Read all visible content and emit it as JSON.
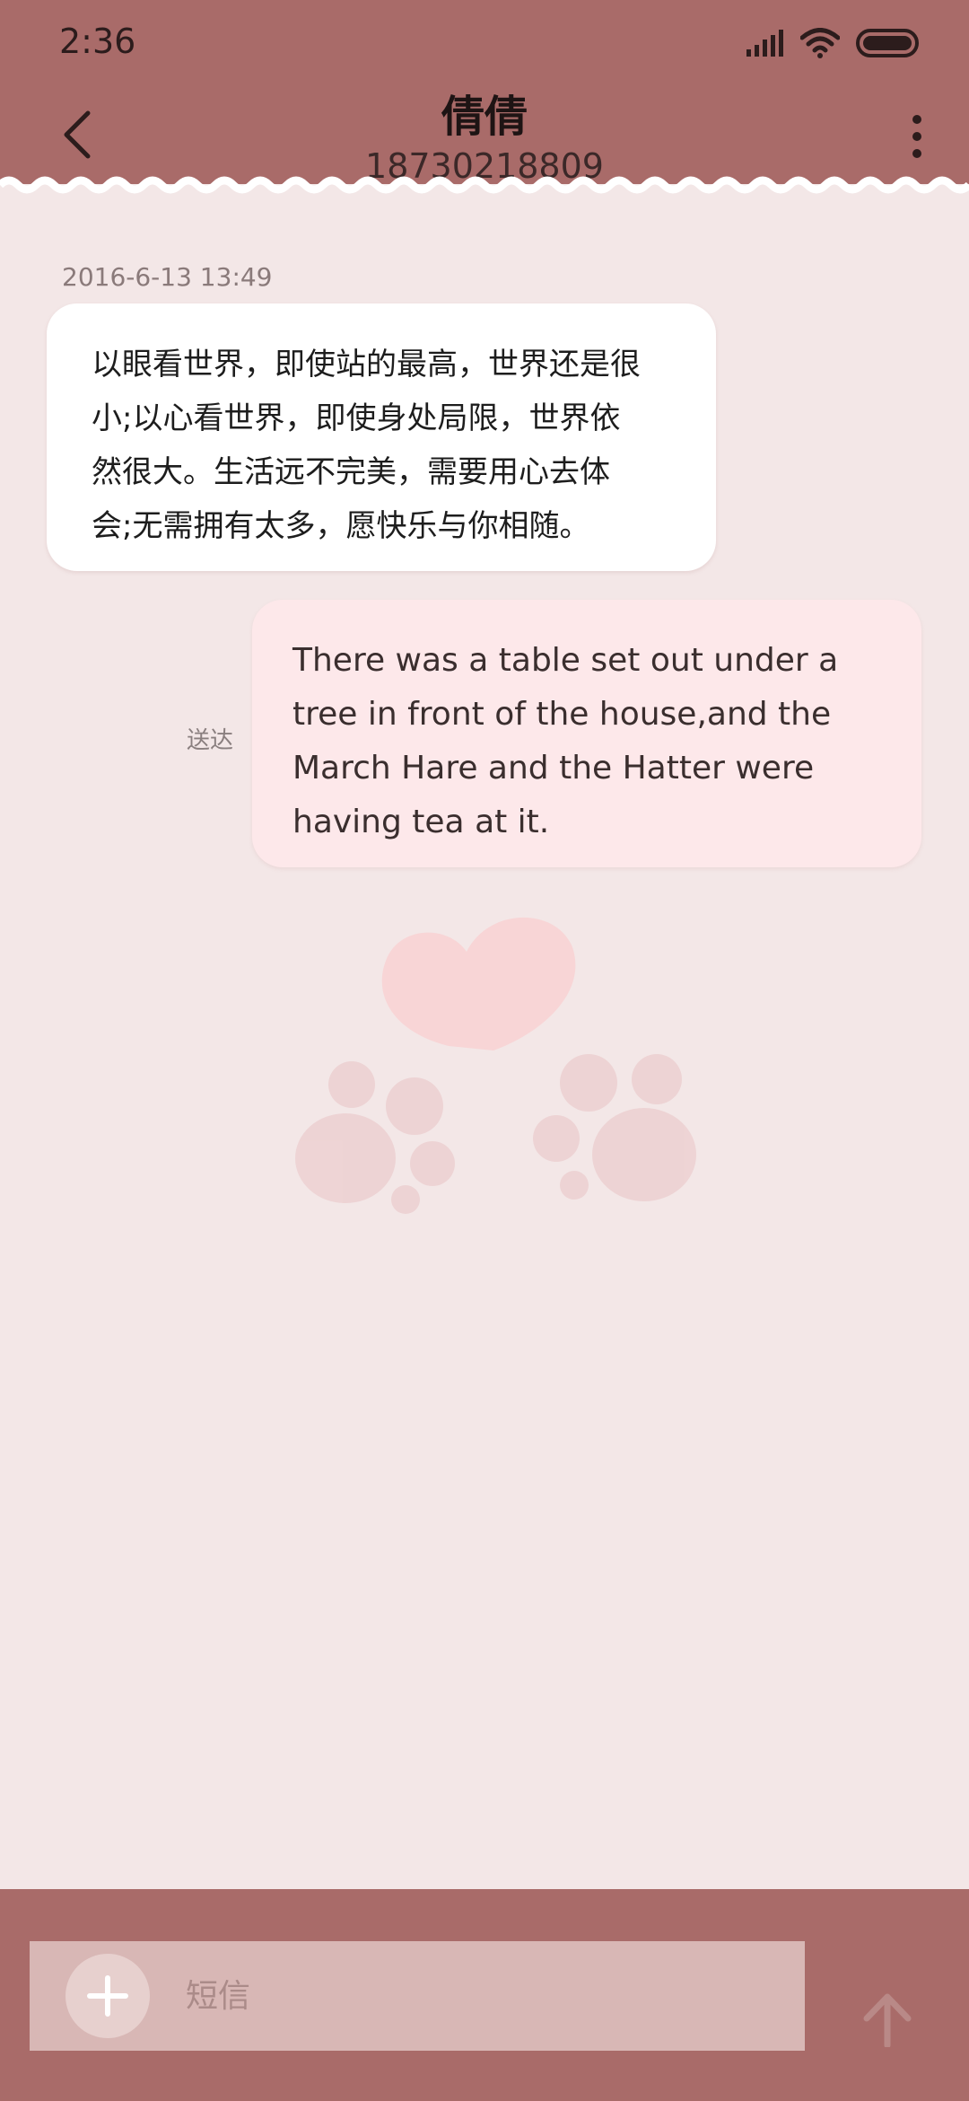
{
  "status_bar": {
    "time": "2:36",
    "icons": [
      "signal-icon",
      "wifi-icon",
      "battery-icon"
    ]
  },
  "header": {
    "back_icon": "chevron-left-icon",
    "contact_name": "倩倩",
    "contact_number": "18730218809",
    "more_icon": "more-vertical-icon"
  },
  "conversation": {
    "timestamp": "2016-6-13 13:49",
    "messages": [
      {
        "direction": "incoming",
        "text": "以眼看世界，即使站的最高，世界还是很\n小;以心看世界，即使身处局限，世界依\n然很大。生活远不完美，需要用心去体\n会;无需拥有太多，愿快乐与你相随。"
      },
      {
        "direction": "outgoing",
        "status": "送达",
        "text": "There was a table set out under a tree in front of the house,and the March Hare and the Hatter were having tea at it."
      }
    ]
  },
  "composer": {
    "add_icon": "plus-icon",
    "placeholder": "短信",
    "value": "",
    "send_icon": "send-arrow-icon"
  },
  "colors": {
    "header_bg": "#a96b69",
    "page_bg": "#f3e7e7",
    "incoming_bubble": "#ffffff",
    "outgoing_bubble": "#fde8ea",
    "input_bg": "#d8b7b5"
  }
}
